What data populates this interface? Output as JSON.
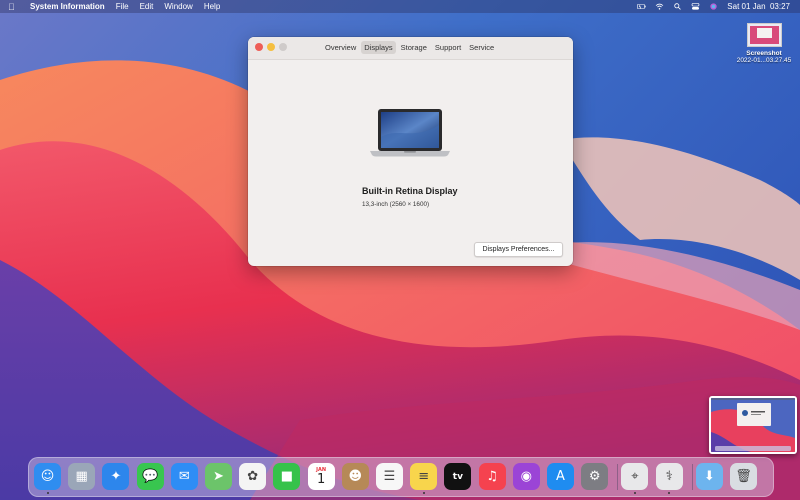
{
  "menubar": {
    "app_name": "System Information",
    "menus": [
      "File",
      "Edit",
      "Window",
      "Help"
    ],
    "clock": "Sat 01 Jan  03:27",
    "icons": [
      "battery-icon",
      "wifi-icon",
      "spotlight-icon",
      "control-center-icon",
      "siri-icon"
    ]
  },
  "window": {
    "tabs": [
      "Overview",
      "Displays",
      "Storage",
      "Support",
      "Service"
    ],
    "active_tab": "Displays",
    "display_name": "Built-in Retina Display",
    "display_spec": "13,3-inch (2560 × 1600)",
    "prefs_button": "Displays Preferences..."
  },
  "desktop_file": {
    "name_line1": "Screenshot",
    "name_line2": "2022-01...03.27.45"
  },
  "dock": {
    "apps": [
      {
        "name": "Finder",
        "icon": "finder-icon",
        "color": "#2f8df0",
        "running": true
      },
      {
        "name": "Launchpad",
        "icon": "launchpad-icon",
        "color": "#9aa6b8",
        "running": false
      },
      {
        "name": "Safari",
        "icon": "safari-icon",
        "color": "#2d86ec",
        "running": false
      },
      {
        "name": "Messages",
        "icon": "messages-icon",
        "color": "#38c64f",
        "running": false
      },
      {
        "name": "Mail",
        "icon": "mail-icon",
        "color": "#2e8df5",
        "running": false
      },
      {
        "name": "Maps",
        "icon": "maps-icon",
        "color": "#6cc46a",
        "running": false
      },
      {
        "name": "Photos",
        "icon": "photos-icon",
        "color": "#f4f4f4",
        "running": false
      },
      {
        "name": "FaceTime",
        "icon": "facetime-icon",
        "color": "#36c24a",
        "running": false
      },
      {
        "name": "Calendar",
        "icon": "calendar-icon",
        "color": "#ffffff",
        "running": false,
        "month": "JAN",
        "day": "1"
      },
      {
        "name": "Contacts",
        "icon": "contacts-icon",
        "color": "#b68957",
        "running": false
      },
      {
        "name": "Reminders",
        "icon": "reminders-icon",
        "color": "#f7f7f7",
        "running": false
      },
      {
        "name": "Notes",
        "icon": "notes-icon",
        "color": "#f8d54c",
        "running": true
      },
      {
        "name": "Apple TV",
        "icon": "tv-icon",
        "color": "#111111",
        "running": false,
        "text": "tv"
      },
      {
        "name": "Music",
        "icon": "music-icon",
        "color": "#f5424f",
        "running": false
      },
      {
        "name": "Podcasts",
        "icon": "podcasts-icon",
        "color": "#9b44d6",
        "running": false
      },
      {
        "name": "App Store",
        "icon": "app-store-icon",
        "color": "#1f8cf0",
        "running": false
      },
      {
        "name": "System Preferences",
        "icon": "system-preferences-icon",
        "color": "#7d7d83",
        "running": false
      },
      {
        "name": "Screenshot Utility",
        "icon": "screenshot-utility-icon",
        "color": "#e8e8ea",
        "running": true
      },
      {
        "name": "System Information",
        "icon": "system-information-icon",
        "color": "#e8e8ea",
        "running": true
      },
      {
        "name": "Downloads",
        "icon": "downloads-folder-icon",
        "color": "#6db4ee",
        "running": false
      },
      {
        "name": "Trash",
        "icon": "trash-icon",
        "color": "#d9dde2",
        "running": false
      }
    ]
  }
}
